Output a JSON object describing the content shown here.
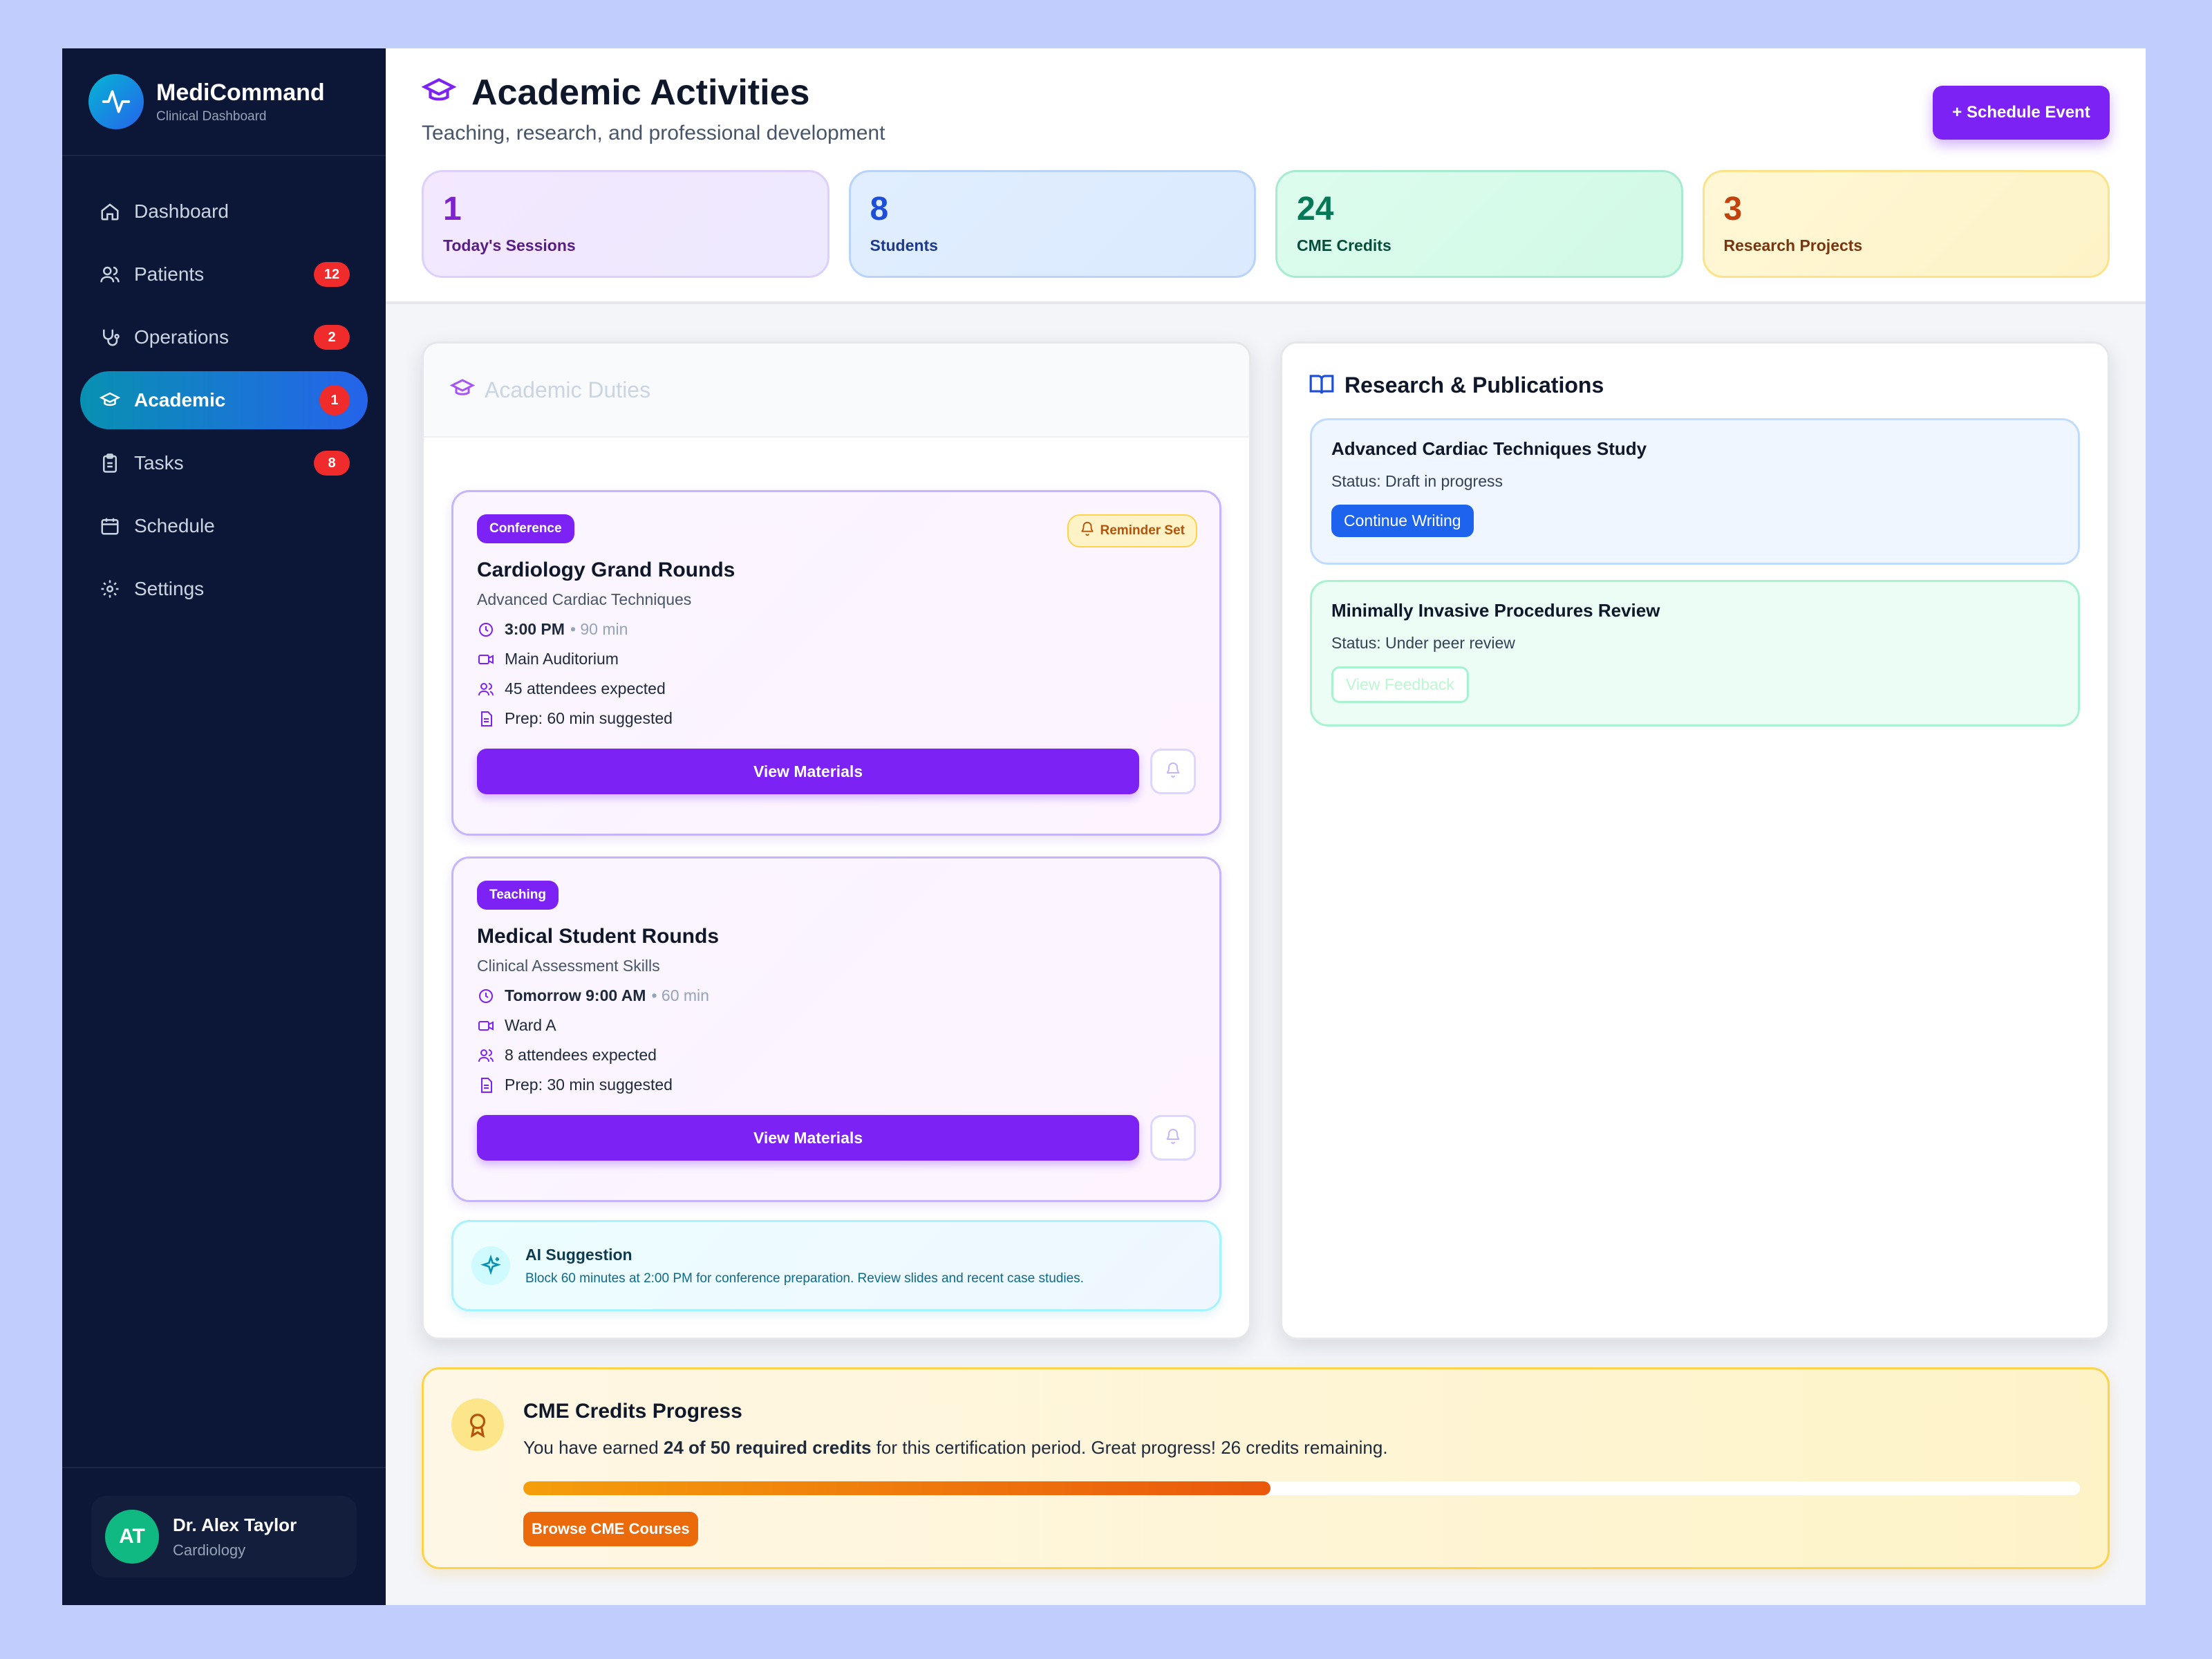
{
  "brand": {
    "name": "MediCommand",
    "subtitle": "Clinical Dashboard"
  },
  "sidebar": {
    "items": [
      {
        "label": "Dashboard",
        "icon": "home-icon",
        "badge": ""
      },
      {
        "label": "Patients",
        "icon": "users-icon",
        "badge": "12"
      },
      {
        "label": "Operations",
        "icon": "stethoscope-icon",
        "badge": "2"
      },
      {
        "label": "Academic",
        "icon": "graduation-cap-icon",
        "badge": "1",
        "active": true
      },
      {
        "label": "Tasks",
        "icon": "clipboard-icon",
        "badge": "8"
      },
      {
        "label": "Schedule",
        "icon": "calendar-icon",
        "badge": ""
      },
      {
        "label": "Settings",
        "icon": "gear-icon",
        "badge": ""
      }
    ]
  },
  "user": {
    "initials": "AT",
    "name": "Dr. Alex Taylor",
    "role": "Cardiology"
  },
  "header": {
    "title": "Academic Activities",
    "subtitle": "Teaching, research, and professional development",
    "schedule_button": "+ Schedule Event"
  },
  "stats": [
    {
      "value": "1",
      "label": "Today's Sessions"
    },
    {
      "value": "8",
      "label": "Students"
    },
    {
      "value": "24",
      "label": "CME Credits"
    },
    {
      "value": "3",
      "label": "Research Projects"
    }
  ],
  "duties": {
    "title": "Academic Duties",
    "items": [
      {
        "tag": "Conference",
        "reminder": "Reminder Set",
        "title": "Cardiology Grand Rounds",
        "subtitle": "Advanced Cardiac Techniques",
        "time": "3:00 PM",
        "duration": "• 90 min",
        "location": "Main Auditorium",
        "attendees": "45 attendees expected",
        "prep": "Prep: 60 min suggested",
        "button": "View Materials"
      },
      {
        "tag": "Teaching",
        "title": "Medical Student Rounds",
        "subtitle": "Clinical Assessment Skills",
        "time": "Tomorrow 9:00 AM",
        "duration": "• 60 min",
        "location": "Ward A",
        "attendees": "8 attendees expected",
        "prep": "Prep: 30 min suggested",
        "button": "View Materials"
      }
    ],
    "ai": {
      "title": "AI Suggestion",
      "text": "Block 60 minutes at 2:00 PM for conference preparation. Review slides and recent case studies."
    }
  },
  "research": {
    "title": "Research & Publications",
    "items": [
      {
        "title": "Advanced Cardiac Techniques Study",
        "status": "Status: Draft in progress",
        "button": "Continue Writing"
      },
      {
        "title": "Minimally Invasive Procedures Review",
        "status": "Status: Under peer review",
        "button": "View Feedback"
      }
    ]
  },
  "cme": {
    "title": "CME Credits Progress",
    "text_before": "You have earned ",
    "text_bold": "24 of 50 required credits",
    "text_after": " for this certification period. Great progress! 26 credits remaining.",
    "progress_fraction": 0.48,
    "button": "Browse CME Courses"
  },
  "colors": {
    "accent": "#7c22f5",
    "sidebar_bg": "#0c1636",
    "active_nav": "#2563eb",
    "badge": "#ef2b2b"
  }
}
